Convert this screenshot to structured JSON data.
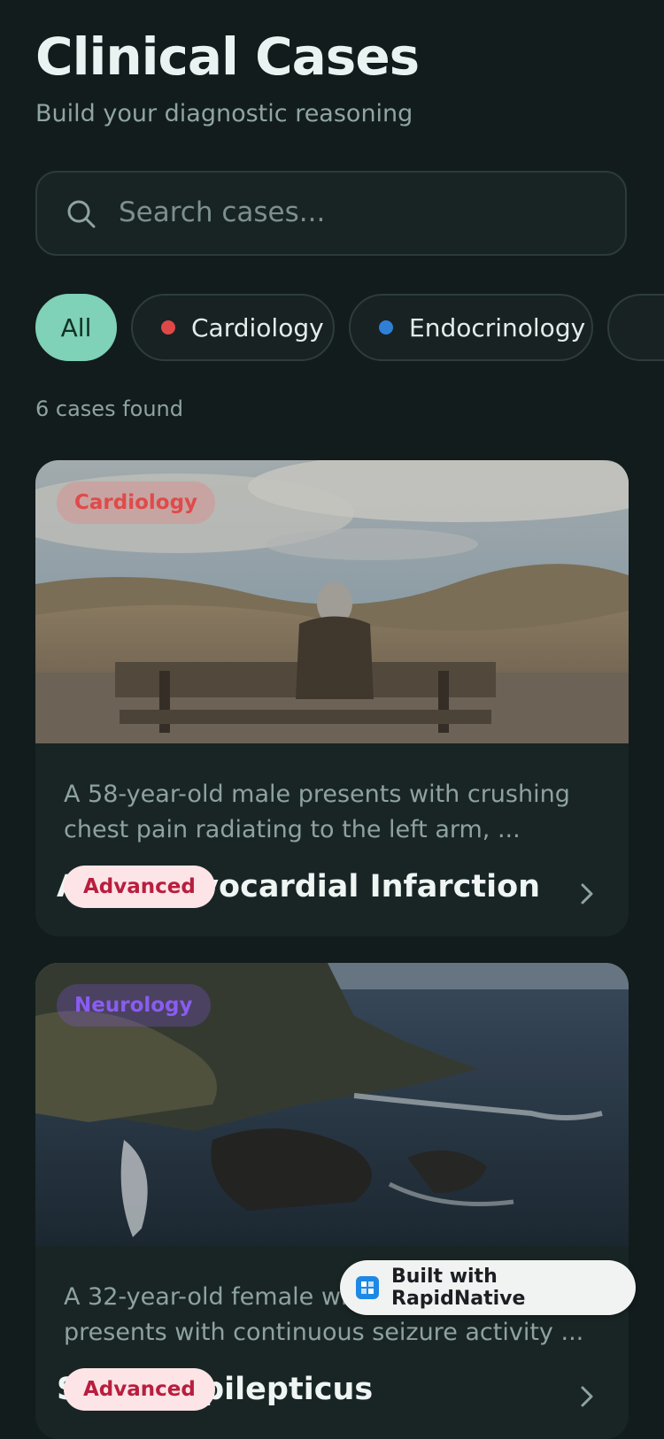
{
  "header": {
    "title": "Clinical Cases",
    "subtitle": "Build your diagnostic reasoning"
  },
  "search": {
    "placeholder": "Search cases..."
  },
  "filters": [
    {
      "label": "All",
      "active": true
    },
    {
      "label": "Cardiology",
      "dot_color": "#e04848"
    },
    {
      "label": "Endocrinology",
      "dot_color": "#2f7fd6"
    }
  ],
  "results": {
    "count_text": "6 cases found"
  },
  "cases": [
    {
      "specialty": "Cardiology",
      "specialty_color": "#e35151",
      "description": "A 58-year-old male presents with crushing chest pain radiating to the left arm, ...",
      "title": "Acute Myocardial Infarction",
      "level": "Advanced"
    },
    {
      "specialty": "Neurology",
      "specialty_color": "#8a5cf0",
      "description": "A 32-year-old female with known epilepsy presents with continuous seizure activity ...",
      "title": "Status Epilepticus",
      "level": "Advanced"
    }
  ],
  "branding": {
    "label": "Built with RapidNative"
  },
  "colors": {
    "background": "#121c1c",
    "accent": "#7fd1b7",
    "card": "#192525"
  }
}
